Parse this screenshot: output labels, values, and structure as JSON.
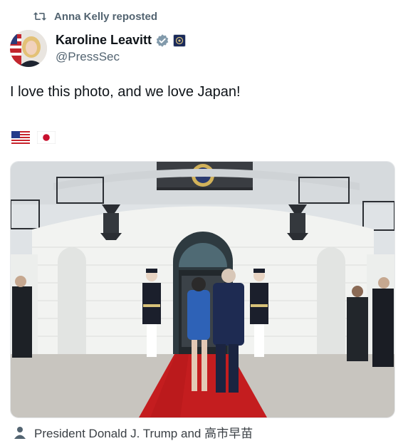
{
  "repost": {
    "text": "Anna Kelly reposted",
    "icon": "repost-icon"
  },
  "author": {
    "display_name": "Karoline Leavitt",
    "handle": "@PressSec",
    "verified_color": "#829aab",
    "affiliation_color": "#1b2a5a"
  },
  "post": {
    "text": "I love this photo, and we love Japan!",
    "emojis": [
      "us-flag-icon",
      "japan-flag-icon"
    ]
  },
  "photo": {
    "subject": "photo-of-leaders-at-white-house-entrance"
  },
  "caption": {
    "text": "President Donald J. Trump and 高市早苗",
    "icon": "person-tag-icon"
  },
  "colors": {
    "text": "#0f1419",
    "muted": "#536471",
    "carpet": "#c41d1f"
  }
}
